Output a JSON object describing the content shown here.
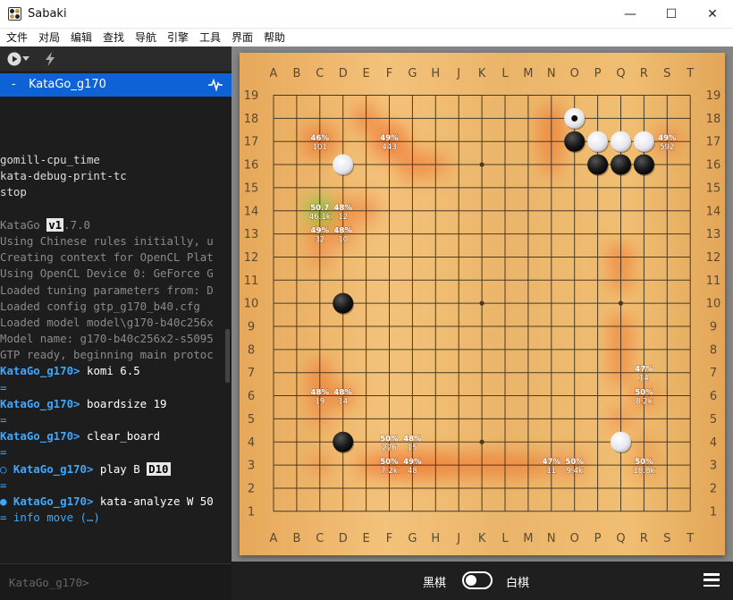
{
  "app": {
    "title": "Sabaki"
  },
  "window_controls": {
    "minimize": "—",
    "maximize": "☐",
    "close": "✕"
  },
  "menu": [
    "文件",
    "对局",
    "编辑",
    "查找",
    "导航",
    "引擎",
    "工具",
    "界面",
    "帮助"
  ],
  "sidebar": {
    "toolbar": {
      "run_icon": "play-circle-icon",
      "dropdown_icon": "chevron-down-icon",
      "attach_icon": "lightning-icon"
    },
    "engine": {
      "name": "KataGo_g170",
      "bullet": "-",
      "activity_icon": "pulse-icon"
    },
    "console_input_placeholder": "KataGo_g170>"
  },
  "console": [
    {
      "type": "out",
      "text": "gomill-cpu_time"
    },
    {
      "type": "out",
      "text": "kata-debug-print-tc"
    },
    {
      "type": "out",
      "text": "stop"
    },
    {
      "type": "blank",
      "text": ""
    },
    {
      "type": "ver",
      "pre": "KataGo ",
      "hl": "v1",
      "post": ".7.0"
    },
    {
      "type": "log",
      "text": "Using Chinese rules initially, u"
    },
    {
      "type": "log",
      "text": "Creating context for OpenCL Plat"
    },
    {
      "type": "log",
      "text": "Using OpenCL Device 0: GeForce G"
    },
    {
      "type": "log",
      "text": "Loaded tuning parameters from: D"
    },
    {
      "type": "log",
      "text": "Loaded config gtp_g170_b40.cfg"
    },
    {
      "type": "log",
      "text": "Loaded model model\\g170-b40c256x"
    },
    {
      "type": "log",
      "text": "Model name: g170-b40c256x2-s5095"
    },
    {
      "type": "log",
      "text": "GTP ready, beginning main protoc"
    },
    {
      "type": "cmd",
      "prefix": "",
      "name": "KataGo_g170>",
      "cmd": " komi 6.5"
    },
    {
      "type": "eq",
      "text": "="
    },
    {
      "type": "cmd",
      "prefix": "",
      "name": "KataGo_g170>",
      "cmd": " boardsize 19"
    },
    {
      "type": "eq",
      "text": "="
    },
    {
      "type": "cmd",
      "prefix": "",
      "name": "KataGo_g170>",
      "cmd": " clear_board"
    },
    {
      "type": "eq",
      "text": "="
    },
    {
      "type": "cmd",
      "prefix": "○ ",
      "name": "KataGo_g170>",
      "cmd": " play B ",
      "hl": "D10"
    },
    {
      "type": "eq",
      "text": "="
    },
    {
      "type": "cmd",
      "prefix": "● ",
      "name": "KataGo_g170>",
      "cmd": " kata-analyze W 50"
    },
    {
      "type": "eq",
      "text": "= info move (…)"
    }
  ],
  "board": {
    "columns": [
      "A",
      "B",
      "C",
      "D",
      "E",
      "F",
      "G",
      "H",
      "J",
      "K",
      "L",
      "M",
      "N",
      "O",
      "P",
      "Q",
      "R",
      "S",
      "T"
    ],
    "rows": [
      "19",
      "18",
      "17",
      "16",
      "15",
      "14",
      "13",
      "12",
      "11",
      "10",
      "9",
      "8",
      "7",
      "6",
      "5",
      "4",
      "3",
      "2",
      "1"
    ],
    "hoshi": [
      "D16",
      "K16",
      "Q16",
      "D10",
      "K10",
      "Q10",
      "D4",
      "K4",
      "Q4"
    ],
    "stones": [
      {
        "color": "black",
        "point": "D10"
      },
      {
        "color": "black",
        "point": "D4"
      },
      {
        "color": "black",
        "point": "O17"
      },
      {
        "color": "black",
        "point": "P16"
      },
      {
        "color": "black",
        "point": "Q16"
      },
      {
        "color": "black",
        "point": "R16"
      },
      {
        "color": "white",
        "point": "D16"
      },
      {
        "color": "white",
        "point": "O18",
        "last_move": true
      },
      {
        "color": "white",
        "point": "P17"
      },
      {
        "color": "white",
        "point": "Q17"
      },
      {
        "color": "white",
        "point": "R17"
      },
      {
        "color": "white",
        "point": "Q4"
      }
    ],
    "heat_blobs": [
      {
        "point": "E18",
        "r": 1.2,
        "color": "#ef6d2a",
        "o": 0.55
      },
      {
        "point": "C17",
        "r": 1.5,
        "color": "#ef6d2a",
        "o": 0.6
      },
      {
        "point": "F17",
        "r": 1.6,
        "color": "#ef6d2a",
        "o": 0.65
      },
      {
        "point": "G16",
        "r": 1.4,
        "color": "#ef6d2a",
        "o": 0.5
      },
      {
        "point": "H16",
        "r": 1.2,
        "color": "#ef6d2a",
        "o": 0.4
      },
      {
        "point": "N18",
        "r": 1.2,
        "color": "#ef6d2a",
        "o": 0.55
      },
      {
        "point": "N17",
        "r": 1.3,
        "color": "#ef6d2a",
        "o": 0.55
      },
      {
        "point": "N16",
        "r": 1.0,
        "color": "#ef6d2a",
        "o": 0.45
      },
      {
        "point": "S17",
        "r": 1.1,
        "color": "#ef6d2a",
        "o": 0.55
      },
      {
        "point": "D14",
        "r": 1.1,
        "color": "#ef6d2a",
        "o": 0.55
      },
      {
        "point": "E14",
        "r": 1.1,
        "color": "#ef6d2a",
        "o": 0.45
      },
      {
        "point": "C13",
        "r": 1.0,
        "color": "#ef6d2a",
        "o": 0.6
      },
      {
        "point": "D13",
        "r": 1.0,
        "color": "#ef6d2a",
        "o": 0.5
      },
      {
        "point": "C12",
        "r": 0.9,
        "color": "#ef6d2a",
        "o": 0.45
      },
      {
        "point": "C14",
        "r": 1.2,
        "color": "#86c23a",
        "o": 0.9
      },
      {
        "point": "Q12",
        "r": 1.2,
        "color": "#ef6d2a",
        "o": 0.55
      },
      {
        "point": "Q11",
        "r": 1.1,
        "color": "#ef6d2a",
        "o": 0.5
      },
      {
        "point": "Q9",
        "r": 1.1,
        "color": "#ef6d2a",
        "o": 0.55
      },
      {
        "point": "Q8",
        "r": 1.1,
        "color": "#ef6d2a",
        "o": 0.55
      },
      {
        "point": "Q7",
        "r": 1.1,
        "color": "#ef6d2a",
        "o": 0.5
      },
      {
        "point": "R6",
        "r": 1.1,
        "color": "#ef6d2a",
        "o": 0.55
      },
      {
        "point": "Q5",
        "r": 1.0,
        "color": "#ef6d2a",
        "o": 0.45
      },
      {
        "point": "C7",
        "r": 1.1,
        "color": "#ef6d2a",
        "o": 0.55
      },
      {
        "point": "C6",
        "r": 1.1,
        "color": "#ef6d2a",
        "o": 0.6
      },
      {
        "point": "D6",
        "r": 1.1,
        "color": "#ef6d2a",
        "o": 0.55
      },
      {
        "point": "C5",
        "r": 0.9,
        "color": "#ef6d2a",
        "o": 0.4
      },
      {
        "point": "C3",
        "r": 0.9,
        "color": "#ef6d2a",
        "o": 0.45
      },
      {
        "point": "E3",
        "r": 1.0,
        "color": "#ef6d2a",
        "o": 0.5
      },
      {
        "point": "F3",
        "r": 1.3,
        "color": "#ef6d2a",
        "o": 0.65
      },
      {
        "point": "G3",
        "r": 1.3,
        "color": "#ef6d2a",
        "o": 0.65
      },
      {
        "point": "H3",
        "r": 1.3,
        "color": "#ef6d2a",
        "o": 0.6
      },
      {
        "point": "J3",
        "r": 1.2,
        "color": "#ef6d2a",
        "o": 0.55
      },
      {
        "point": "K3",
        "r": 1.2,
        "color": "#ef6d2a",
        "o": 0.55
      },
      {
        "point": "L3",
        "r": 1.2,
        "color": "#ef6d2a",
        "o": 0.55
      },
      {
        "point": "M3",
        "r": 1.1,
        "color": "#ef6d2a",
        "o": 0.55
      },
      {
        "point": "N3",
        "r": 1.0,
        "color": "#ef6d2a",
        "o": 0.45
      },
      {
        "point": "O3",
        "r": 1.0,
        "color": "#ef6d2a",
        "o": 0.5
      },
      {
        "point": "R3",
        "r": 1.0,
        "color": "#ef6d2a",
        "o": 0.5
      },
      {
        "point": "R4",
        "r": 0.8,
        "color": "#ef6d2a",
        "o": 0.35
      }
    ],
    "analysis": [
      {
        "point": "C17",
        "win": "46%",
        "visits": "101"
      },
      {
        "point": "F17",
        "win": "49%",
        "visits": "443"
      },
      {
        "point": "S17",
        "win": "49%",
        "visits": "592"
      },
      {
        "point": "C14",
        "win": "50.7",
        "visits": "46.1k"
      },
      {
        "point": "D14",
        "win": "48%",
        "visits": "12"
      },
      {
        "point": "C13",
        "win": "49%",
        "visits": "32"
      },
      {
        "point": "D13",
        "win": "48%",
        "visits": "10"
      },
      {
        "point": "R7",
        "win": "47%",
        "visits": "14"
      },
      {
        "point": "C6",
        "win": "48%",
        "visits": "19"
      },
      {
        "point": "D6",
        "win": "48%",
        "visits": "14"
      },
      {
        "point": "R6",
        "win": "50%",
        "visits": "8.2k"
      },
      {
        "point": "F4",
        "win": "50%",
        "visits": "226"
      },
      {
        "point": "G4",
        "win": "48%",
        "visits": "15"
      },
      {
        "point": "F3",
        "win": "50%",
        "visits": "7.2k"
      },
      {
        "point": "G3",
        "win": "49%",
        "visits": "48"
      },
      {
        "point": "N3",
        "win": "47%",
        "visits": "11"
      },
      {
        "point": "O3",
        "win": "50%",
        "visits": "9.4k"
      },
      {
        "point": "R3",
        "win": "50%",
        "visits": "18.8k"
      }
    ]
  },
  "player_toggle": {
    "black_label": "黑棋",
    "white_label": "白棋",
    "active": "black"
  },
  "bottom_menu_icon": "hamburger-menu-icon"
}
